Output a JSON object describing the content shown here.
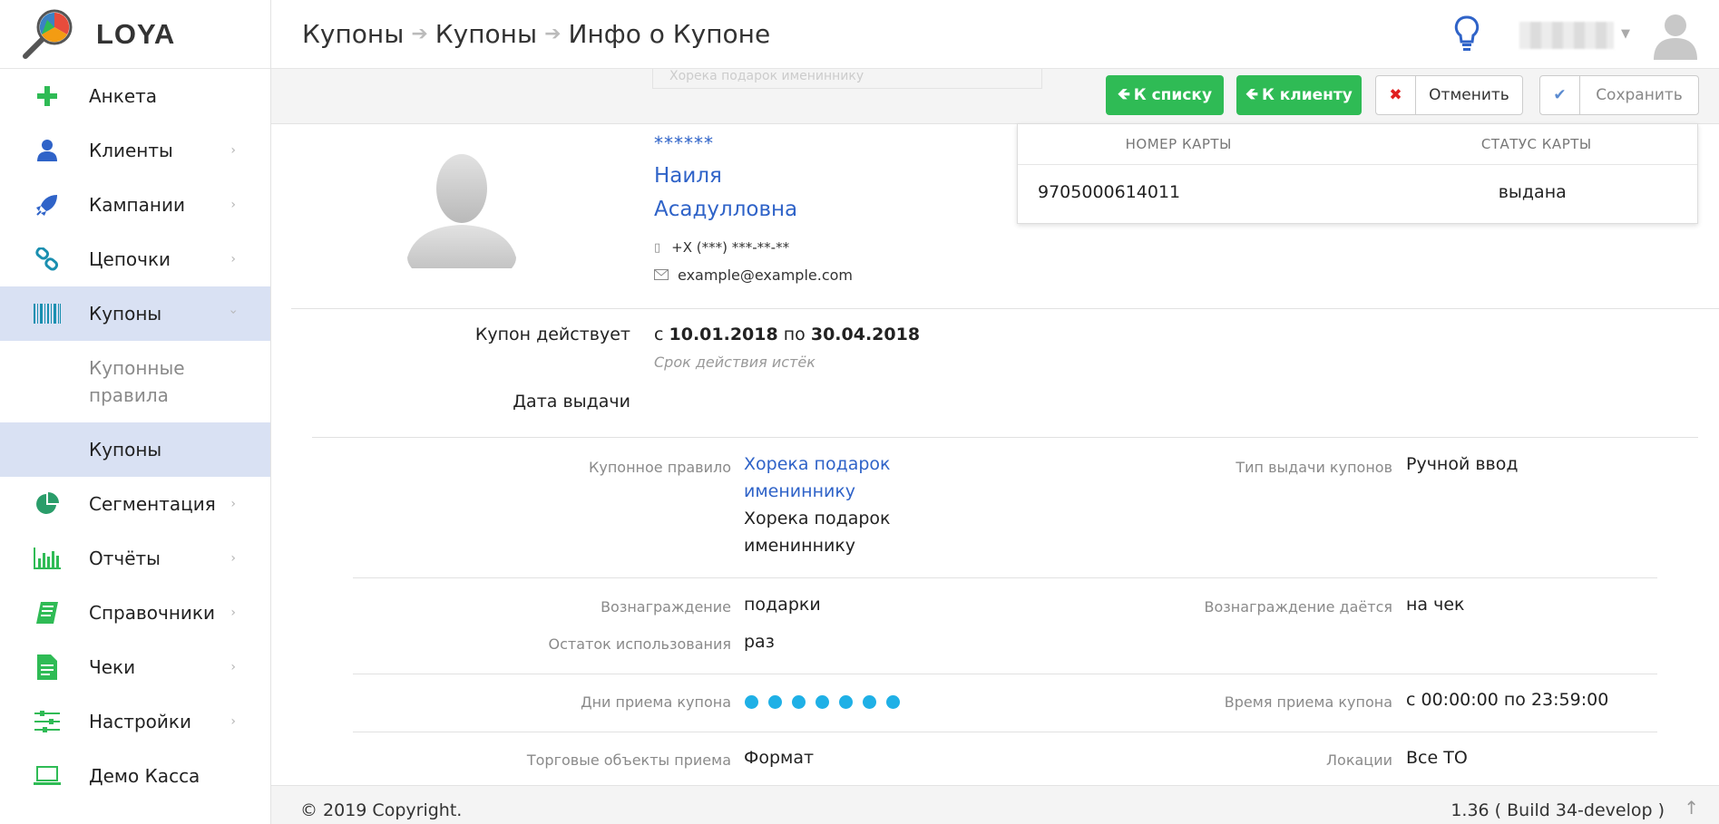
{
  "app": {
    "name": "LOYA"
  },
  "breadcrumb": [
    "Купоны",
    "Купоны",
    "Инфо о Купоне"
  ],
  "sidebar": {
    "items": [
      {
        "label": "Анкета",
        "icon": "plus-icon"
      },
      {
        "label": "Клиенты",
        "icon": "user-icon"
      },
      {
        "label": "Кампании",
        "icon": "rocket-icon"
      },
      {
        "label": "Цепочки",
        "icon": "chain-icon"
      },
      {
        "label": "Купоны",
        "icon": "barcode-icon"
      },
      {
        "label": "Сегментация",
        "icon": "pie-icon"
      },
      {
        "label": "Отчёты",
        "icon": "bar-chart-icon"
      },
      {
        "label": "Справочники",
        "icon": "book-icon"
      },
      {
        "label": "Чеки",
        "icon": "receipt-icon"
      },
      {
        "label": "Настройки",
        "icon": "sliders-icon"
      },
      {
        "label": "Демо Касса",
        "icon": "laptop-icon"
      }
    ],
    "sub_items": [
      {
        "label": "Купонные правила"
      },
      {
        "label": "Купоны"
      }
    ]
  },
  "toolbar": {
    "ghost_field": "Хорека подарок имениннику",
    "to_list": "К списку",
    "to_client": "К клиенту",
    "cancel": "Отменить",
    "save": "Сохранить"
  },
  "client": {
    "masked": "******",
    "name_first": "Наиля",
    "name_second": "Асадулловна",
    "phone": "+X (***) ***-**-**",
    "email": "example@example.com"
  },
  "card_table": {
    "headers": [
      "НОМЕР КАРТЫ",
      "СТАТУС КАРТЫ"
    ],
    "row": [
      "9705000614011",
      "выдана"
    ]
  },
  "coupon": {
    "valid_label": "Купон действует",
    "valid_from_prefix": "с",
    "valid_from": "10.01.2018",
    "valid_to_prefix": "по",
    "valid_to": "30.04.2018",
    "expired_note": "Срок действия истёк",
    "issue_date_label": "Дата выдачи"
  },
  "details": {
    "rule_label": "Купонное правило",
    "rule_link_1": "Хорека подарок",
    "rule_link_2": "имениннику",
    "rule_text_1": "Хорека подарок",
    "rule_text_2": "имениннику",
    "issue_type_label": "Тип выдачи купонов",
    "issue_type_value": "Ручной ввод",
    "reward_label": "Вознаграждение",
    "reward_value": "подарки",
    "reward_given_label": "Вознаграждение даётся",
    "reward_given_value": "на чек",
    "remaining_label": "Остаток использования",
    "remaining_value": "раз",
    "days_label": "Дни приема купона",
    "days_active": [
      true,
      true,
      true,
      true,
      true,
      true,
      true
    ],
    "time_label": "Время приема купона",
    "time_value": "с 00:00:00 по 23:59:00",
    "stores_label": "Торговые объекты приема",
    "stores_value": "Формат",
    "locations_label": "Локации",
    "locations_value": "Все ТО"
  },
  "footer": {
    "copyright": "© 2019 Copyright.",
    "build": "1.36 ( Build 34-develop )"
  },
  "colors": {
    "accent_blue": "#2f63c8",
    "green": "#2fbb55",
    "active_bg": "#d9e1f3",
    "day_dot": "#1fb0e6"
  }
}
